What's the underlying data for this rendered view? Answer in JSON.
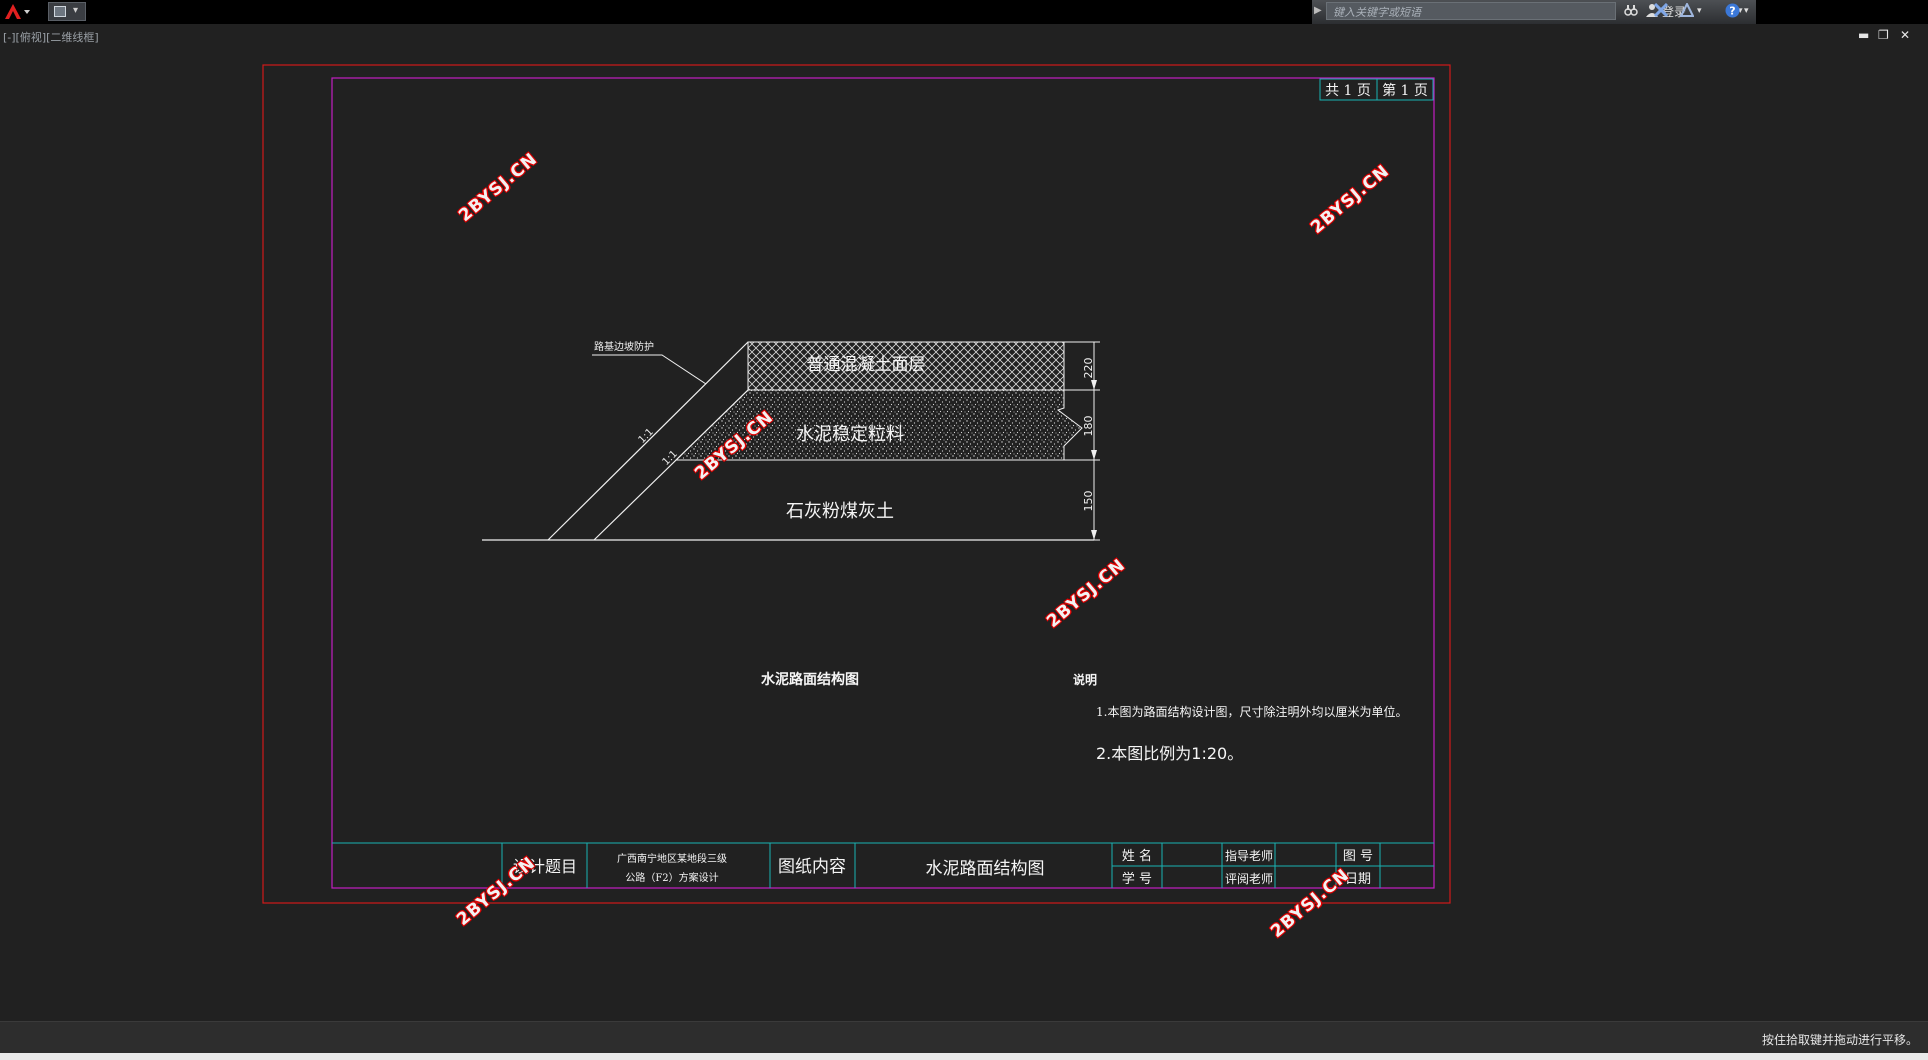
{
  "topbar": {
    "search_placeholder": "键入关键字或短语",
    "login_label": "登录"
  },
  "viewport_label": "[-][俯视][二维线框]",
  "title_block": {
    "page_total": "共 1 页",
    "page_current": "第 1 页",
    "design_topic_label": "设计题目",
    "design_topic_line1": "广西南宁地区某地段三级",
    "design_topic_line2": "公路（F2）方案设计",
    "drawing_content_label": "图纸内容",
    "drawing_content_value": "水泥路面结构图",
    "name_label": "姓 名",
    "student_id_label": "学 号",
    "advisor_label": "指导老师",
    "reviewer_label": "评阅老师",
    "drawing_no_label": "图 号",
    "date_label": "日期"
  },
  "section": {
    "slope_protection_label": "路基边坡防护",
    "layer1_label": "普通混凝土面层",
    "layer2_label": "水泥稳定粒料",
    "layer3_label": "石灰粉煤灰土",
    "dim1": "220",
    "dim2": "180",
    "dim3": "150",
    "slope1": "1:1",
    "slope2": "1:1"
  },
  "drawing_title": "水泥路面结构图",
  "notes": {
    "heading": "说明",
    "note1": "1.本图为路面结构设计图，尺寸除注明外均以厘米为单位。",
    "note2": "2.本图比例为1:20。"
  },
  "watermark_text": "2BYSJ.CN",
  "status_text": "按住拾取键并拖动进行平移。",
  "colors": {
    "background": "#212121",
    "border_red": "#d01a1a",
    "frame_magenta": "#c21ec2",
    "table_cyan": "#19b2b2",
    "line_white": "#f0f0f0"
  }
}
